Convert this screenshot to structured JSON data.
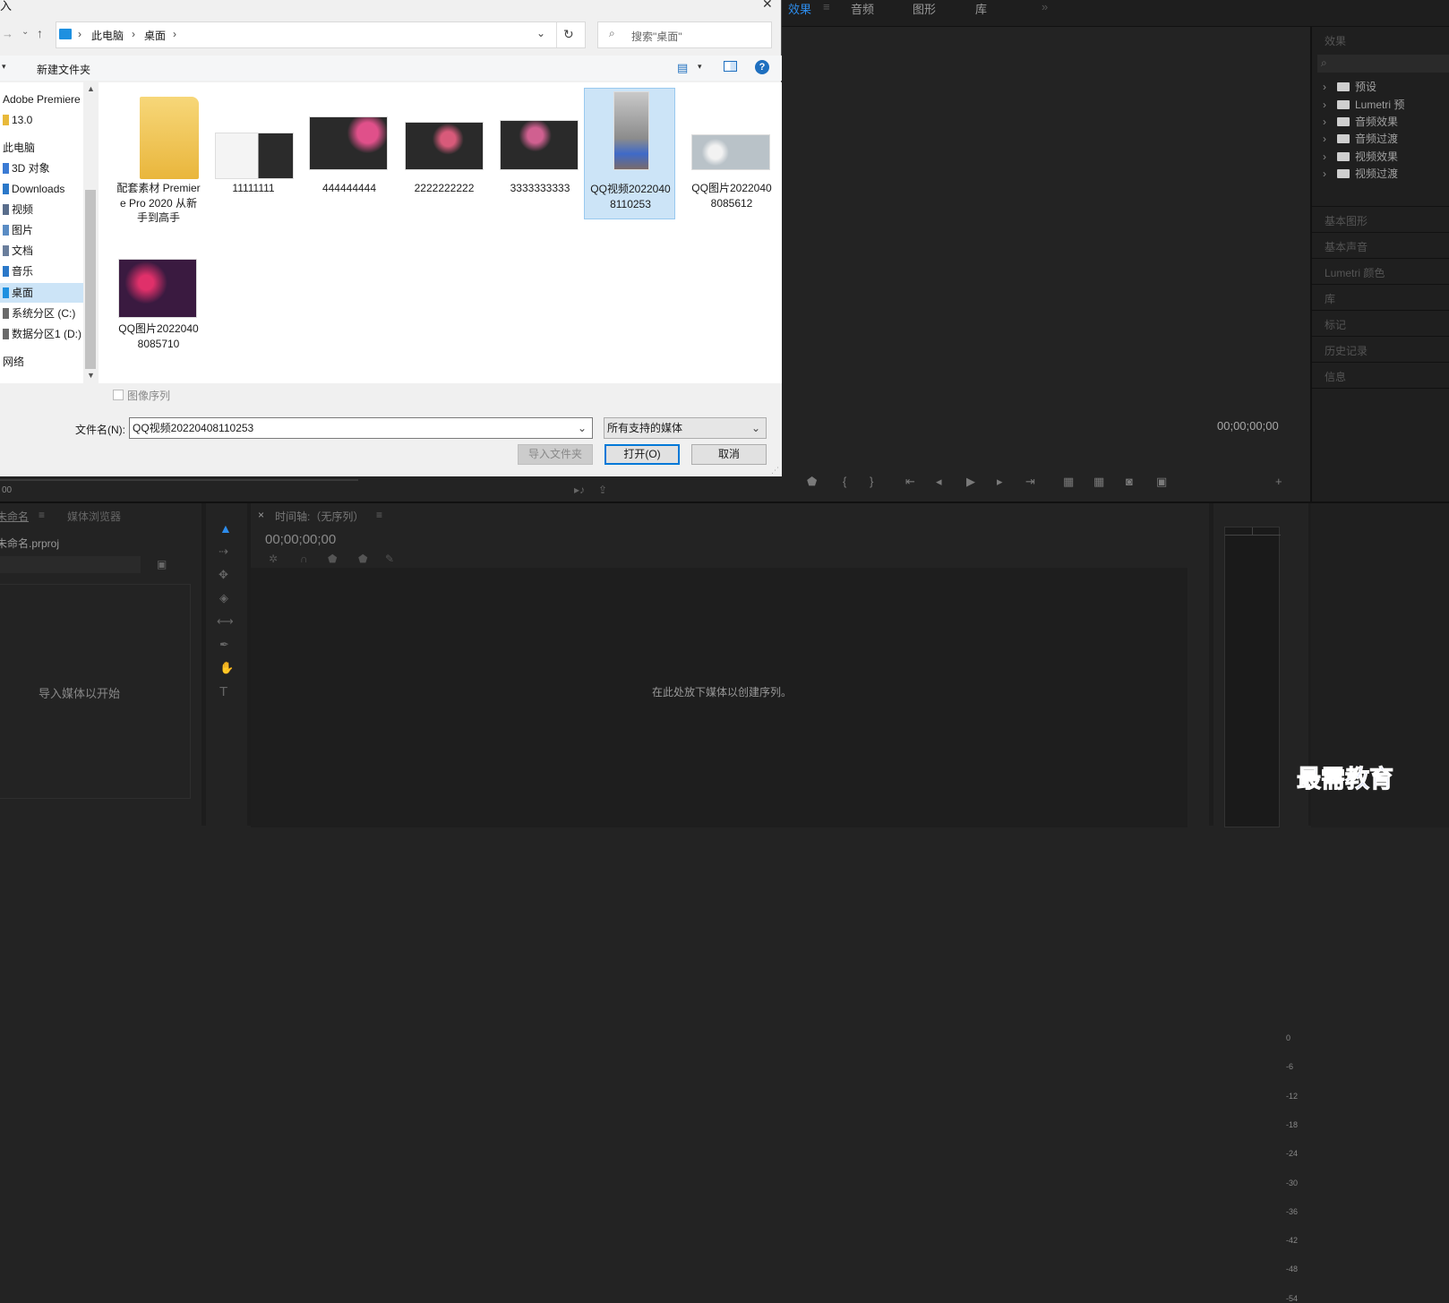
{
  "dialog": {
    "title_fragment": "入",
    "close_glyph": "✕",
    "breadcrumb": [
      "此电脑",
      "桌面"
    ],
    "search_placeholder": "搜索\"桌面\"",
    "new_folder": "新建文件夹",
    "help": "?",
    "nav_items": [
      {
        "label": "Adobe Premiere",
        "icon": "none"
      },
      {
        "label": "13.0",
        "icon": "folder-icon"
      },
      {
        "label": "此电脑",
        "icon": "none"
      },
      {
        "label": "3D 对象",
        "icon": "cube-icon"
      },
      {
        "label": "Downloads",
        "icon": "download-icon"
      },
      {
        "label": "视频",
        "icon": "video-icon"
      },
      {
        "label": "图片",
        "icon": "picture-icon"
      },
      {
        "label": "文档",
        "icon": "document-icon"
      },
      {
        "label": "音乐",
        "icon": "music-icon"
      },
      {
        "label": "桌面",
        "icon": "desktop-icon"
      },
      {
        "label": "系统分区 (C:)",
        "icon": "drive-icon"
      },
      {
        "label": "数据分区1 (D:)",
        "icon": "drive-icon"
      },
      {
        "label": "网络",
        "icon": "none"
      }
    ],
    "files": [
      {
        "name": "配套素材 Premiere Pro 2020 从新手到高手",
        "type": "folder"
      },
      {
        "name": "11111111",
        "type": "screenshot"
      },
      {
        "name": "444444444",
        "type": "screenshot"
      },
      {
        "name": "2222222222",
        "type": "screenshot"
      },
      {
        "name": "3333333333",
        "type": "screenshot"
      },
      {
        "name": "QQ视频20220408110253",
        "type": "video",
        "selected": true
      },
      {
        "name": "QQ图片20220408085612",
        "type": "photo"
      },
      {
        "name": "QQ图片20220408085710",
        "type": "photo"
      }
    ],
    "image_sequence_label": "图像序列",
    "filename_label": "文件名(N):",
    "filename_value": "QQ视频20220408110253",
    "filter_value": "所有支持的媒体",
    "import_folder_button": "导入文件夹",
    "open_button": "打开(O)",
    "cancel_button": "取消"
  },
  "workspace": {
    "tabs": [
      "效果",
      "音频",
      "图形",
      "库"
    ],
    "more_glyph": "»",
    "effects_panel_title": "效果",
    "effects_folders": [
      "预设",
      "Lumetri 预",
      "音频效果",
      "音频过渡",
      "视频效果",
      "视频过渡"
    ],
    "side_panels": [
      "基本图形",
      "基本声音",
      "Lumetri 颜色",
      "库",
      "标记",
      "历史记录",
      "信息"
    ],
    "program_timecode": "00;00;00;00",
    "source_timecode_fragment": "00",
    "project_tab": "未命名",
    "media_browser_tab": "媒体浏览器",
    "project_file": "未命名.prproj",
    "project_empty_text": "导入媒体以开始",
    "timeline_tab": "时间轴:（无序列）",
    "timeline_timecode": "00;00;00;00",
    "timeline_empty_text": "在此处放下媒体以创建序列。",
    "meter_ticks": [
      "0",
      "-6",
      "-12",
      "-18",
      "-24",
      "-30",
      "-36",
      "-42",
      "-48",
      "-54"
    ],
    "watermark": "最需教育"
  }
}
